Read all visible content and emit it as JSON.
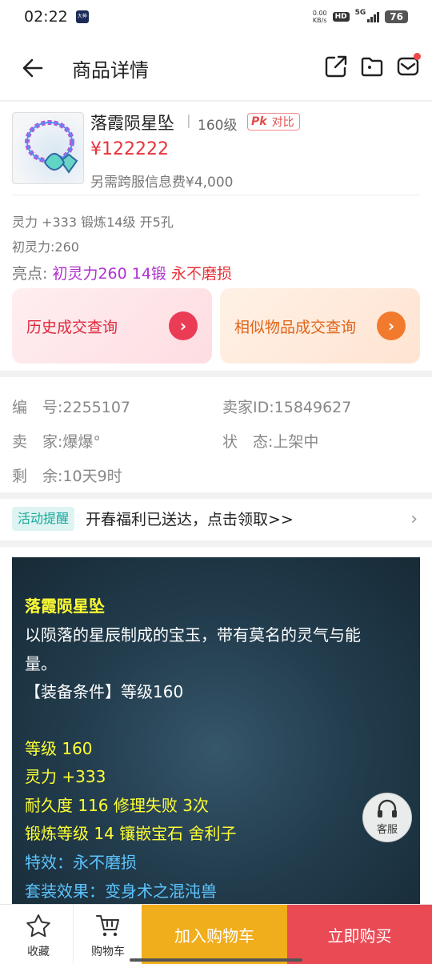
{
  "status_bar": {
    "time": "02:22",
    "app_badge": "大神",
    "net_speed_value": "0.00",
    "net_speed_unit": "KB/s",
    "hd": "HD",
    "network": "5G",
    "battery": "76"
  },
  "header": {
    "title": "商品详情",
    "icons": [
      "back-arrow-icon",
      "share-icon",
      "folder-icon",
      "message-icon"
    ]
  },
  "item": {
    "name": "落霞陨星坠",
    "separator": "|",
    "level": "160级",
    "pk_mark": "Pk",
    "compare_label": "对比",
    "price": "¥122222",
    "cross_server_fee": "另需跨服信息费¥4,000",
    "attr_line": "灵力 +333 锻炼14级 开5孔",
    "initial_power": "初灵力:260",
    "highlights_label": "亮点:",
    "highlights_purple": "初灵力260 14锻",
    "highlights_red": "永不磨损"
  },
  "queries": {
    "history": "历史成交查询",
    "similar": "相似物品成交查询"
  },
  "info": {
    "serial_label": "编　号:",
    "serial_value": "2255107",
    "seller_id_label": "卖家ID:",
    "seller_id_value": "15849627",
    "seller_label": "卖　家:",
    "seller_value": "爆爆°",
    "status_label": "状　态:",
    "status_value": "上架中",
    "remaining_label": "剩　余:",
    "remaining_value": "10天9时"
  },
  "notice": {
    "tag": "活动提醒",
    "text": "开春福利已送达，点击领取>>"
  },
  "description": {
    "name": "落霞陨星坠",
    "flavor_1": "以陨落的星辰制成的宝玉，带有莫名的灵气与能",
    "flavor_2": "量。",
    "requirement": "【装备条件】等级160",
    "level": "等级 160",
    "power": "灵力 +333",
    "durability": "耐久度 116 修理失败 3次",
    "refine": "锻炼等级 14 镶嵌宝石 舍利子",
    "effect": "特效：永不磨损",
    "set": "套装效果：变身术之混沌兽"
  },
  "service": {
    "label": "客服"
  },
  "bottom_bar": {
    "favorite": "收藏",
    "cart": "购物车",
    "add_to_cart": "加入购物车",
    "buy_now": "立即购买"
  },
  "colors": {
    "price_red": "#e8323a",
    "highlight_purple": "#b030d0",
    "desc_yellow": "#ffff33",
    "desc_blue": "#5dc5ff",
    "cart_button": "#f0ad1c",
    "buy_button": "#ea4a54"
  }
}
